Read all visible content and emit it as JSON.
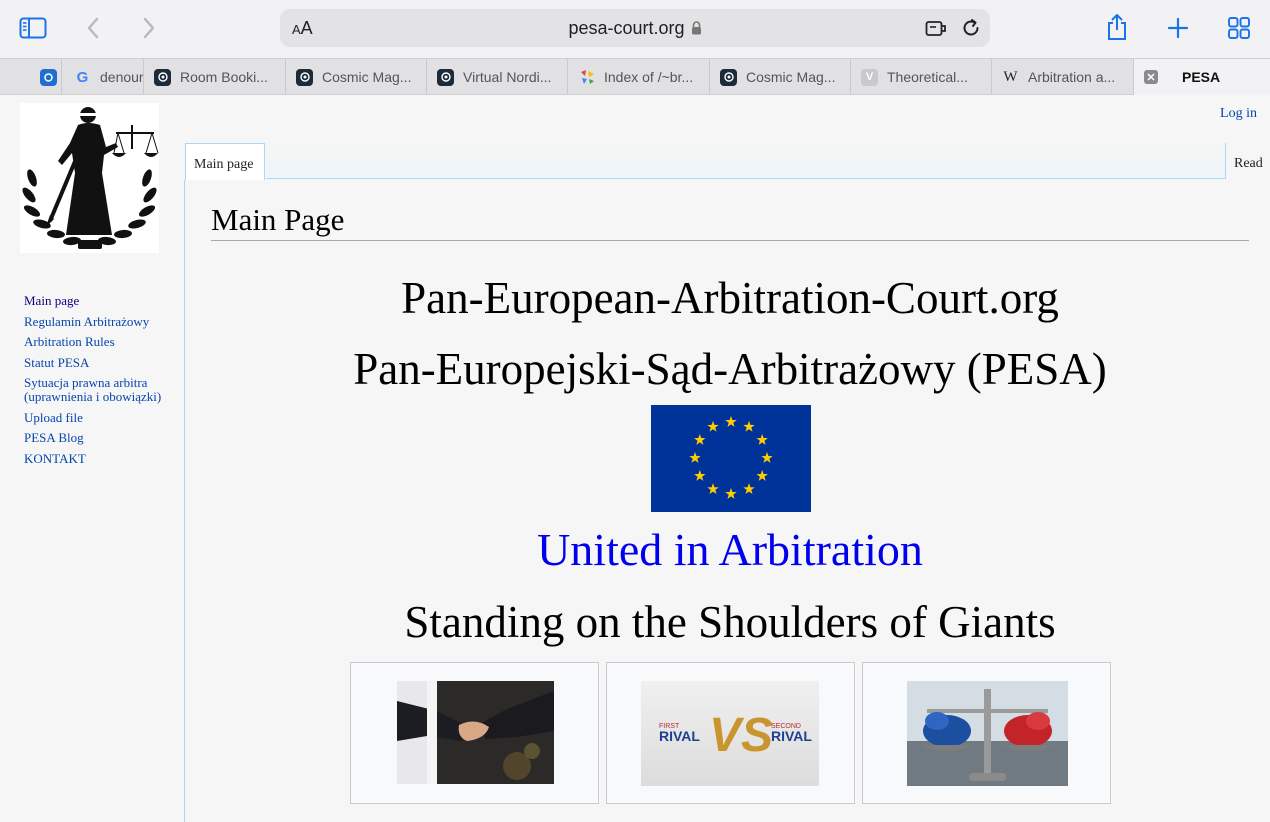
{
  "browser": {
    "url": "pesa-court.org",
    "text_size_label": "AA",
    "tabs": [
      {
        "title": "denour",
        "favicon": "google-icon"
      },
      {
        "title": "Room Booki...",
        "favicon": "cosmic-icon"
      },
      {
        "title": "Cosmic Mag...",
        "favicon": "cosmic-icon"
      },
      {
        "title": "Virtual Nordi...",
        "favicon": "cosmic-icon"
      },
      {
        "title": "Index of /~br...",
        "favicon": "colorful-icon"
      },
      {
        "title": "Cosmic Mag...",
        "favicon": "cosmic-icon"
      },
      {
        "title": "Theoretical...",
        "favicon": "v-icon"
      },
      {
        "title": "Arbitration a...",
        "favicon": "wikipedia-icon"
      },
      {
        "title": "PESA",
        "favicon": "close-icon",
        "active": true
      }
    ]
  },
  "page": {
    "login": "Log in",
    "tabs": {
      "main": "Main page",
      "read": "Read"
    },
    "sidebar": {
      "items": [
        "Main page",
        "Regulamin Arbitrażowy",
        "Arbitration Rules",
        "Statut PESA",
        "Sytuacja prawna arbitra (uprawnienia i obowiązki)",
        "Upload file",
        "PESA Blog",
        "KONTAKT"
      ]
    },
    "title": "Main Page",
    "headline1": "Pan-European-Arbitration-Court.org",
    "headline2": "Pan-Europejski-Sąd-Arbitrażowy (PESA)",
    "slogan": "United in Arbitration",
    "subheadline": "Standing on the Shoulders of Giants",
    "gallery": [
      {
        "name": "handshake-image"
      },
      {
        "name": "first-rival-vs-second-rival-image",
        "left_text": "FIRST",
        "left_word": "RIVAL",
        "vs": "VS",
        "right_text": "SECOND",
        "right_word": "RIVAL"
      },
      {
        "name": "scales-boxing-gloves-image"
      }
    ]
  },
  "colors": {
    "link": "#0645ad",
    "slogan": "#0000ee",
    "eu_blue": "#003399",
    "eu_star": "#ffcc00"
  }
}
